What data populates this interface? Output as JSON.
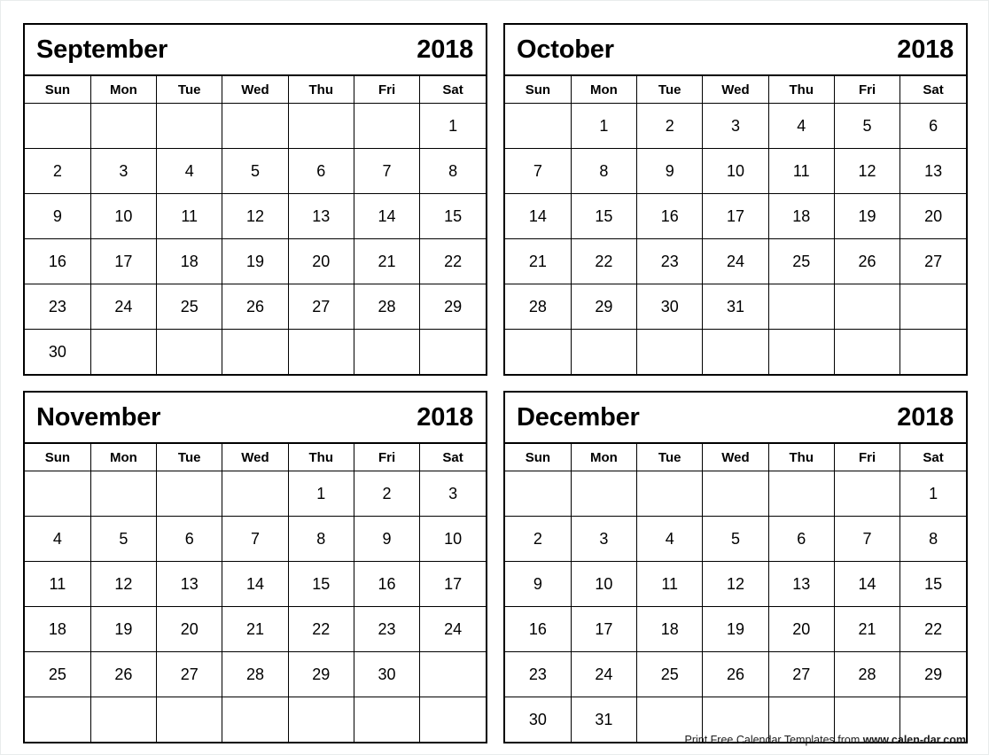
{
  "page": {
    "year": "2018",
    "weekday_headers": [
      "Sun",
      "Mon",
      "Tue",
      "Wed",
      "Thu",
      "Fri",
      "Sat"
    ]
  },
  "footer": {
    "credit_text": "Print Free Calendar Templates from ",
    "site": "www.calen-dar.com"
  },
  "months": [
    {
      "name": "September",
      "year": "2018",
      "weeks": [
        [
          "",
          "",
          "",
          "",
          "",
          "",
          "1"
        ],
        [
          "2",
          "3",
          "4",
          "5",
          "6",
          "7",
          "8"
        ],
        [
          "9",
          "10",
          "11",
          "12",
          "13",
          "14",
          "15"
        ],
        [
          "16",
          "17",
          "18",
          "19",
          "20",
          "21",
          "22"
        ],
        [
          "23",
          "24",
          "25",
          "26",
          "27",
          "28",
          "29"
        ],
        [
          "30",
          "",
          "",
          "",
          "",
          "",
          ""
        ]
      ]
    },
    {
      "name": "October",
      "year": "2018",
      "weeks": [
        [
          "",
          "1",
          "2",
          "3",
          "4",
          "5",
          "6"
        ],
        [
          "7",
          "8",
          "9",
          "10",
          "11",
          "12",
          "13"
        ],
        [
          "14",
          "15",
          "16",
          "17",
          "18",
          "19",
          "20"
        ],
        [
          "21",
          "22",
          "23",
          "24",
          "25",
          "26",
          "27"
        ],
        [
          "28",
          "29",
          "30",
          "31",
          "",
          "",
          ""
        ],
        [
          "",
          "",
          "",
          "",
          "",
          "",
          ""
        ]
      ]
    },
    {
      "name": "November",
      "year": "2018",
      "weeks": [
        [
          "",
          "",
          "",
          "",
          "1",
          "2",
          "3"
        ],
        [
          "4",
          "5",
          "6",
          "7",
          "8",
          "9",
          "10"
        ],
        [
          "11",
          "12",
          "13",
          "14",
          "15",
          "16",
          "17"
        ],
        [
          "18",
          "19",
          "20",
          "21",
          "22",
          "23",
          "24"
        ],
        [
          "25",
          "26",
          "27",
          "28",
          "29",
          "30",
          ""
        ],
        [
          "",
          "",
          "",
          "",
          "",
          "",
          ""
        ]
      ]
    },
    {
      "name": "December",
      "year": "2018",
      "weeks": [
        [
          "",
          "",
          "",
          "",
          "",
          "",
          "1"
        ],
        [
          "2",
          "3",
          "4",
          "5",
          "6",
          "7",
          "8"
        ],
        [
          "9",
          "10",
          "11",
          "12",
          "13",
          "14",
          "15"
        ],
        [
          "16",
          "17",
          "18",
          "19",
          "20",
          "21",
          "22"
        ],
        [
          "23",
          "24",
          "25",
          "26",
          "27",
          "28",
          "29"
        ],
        [
          "30",
          "31",
          "",
          "",
          "",
          "",
          ""
        ]
      ]
    }
  ]
}
